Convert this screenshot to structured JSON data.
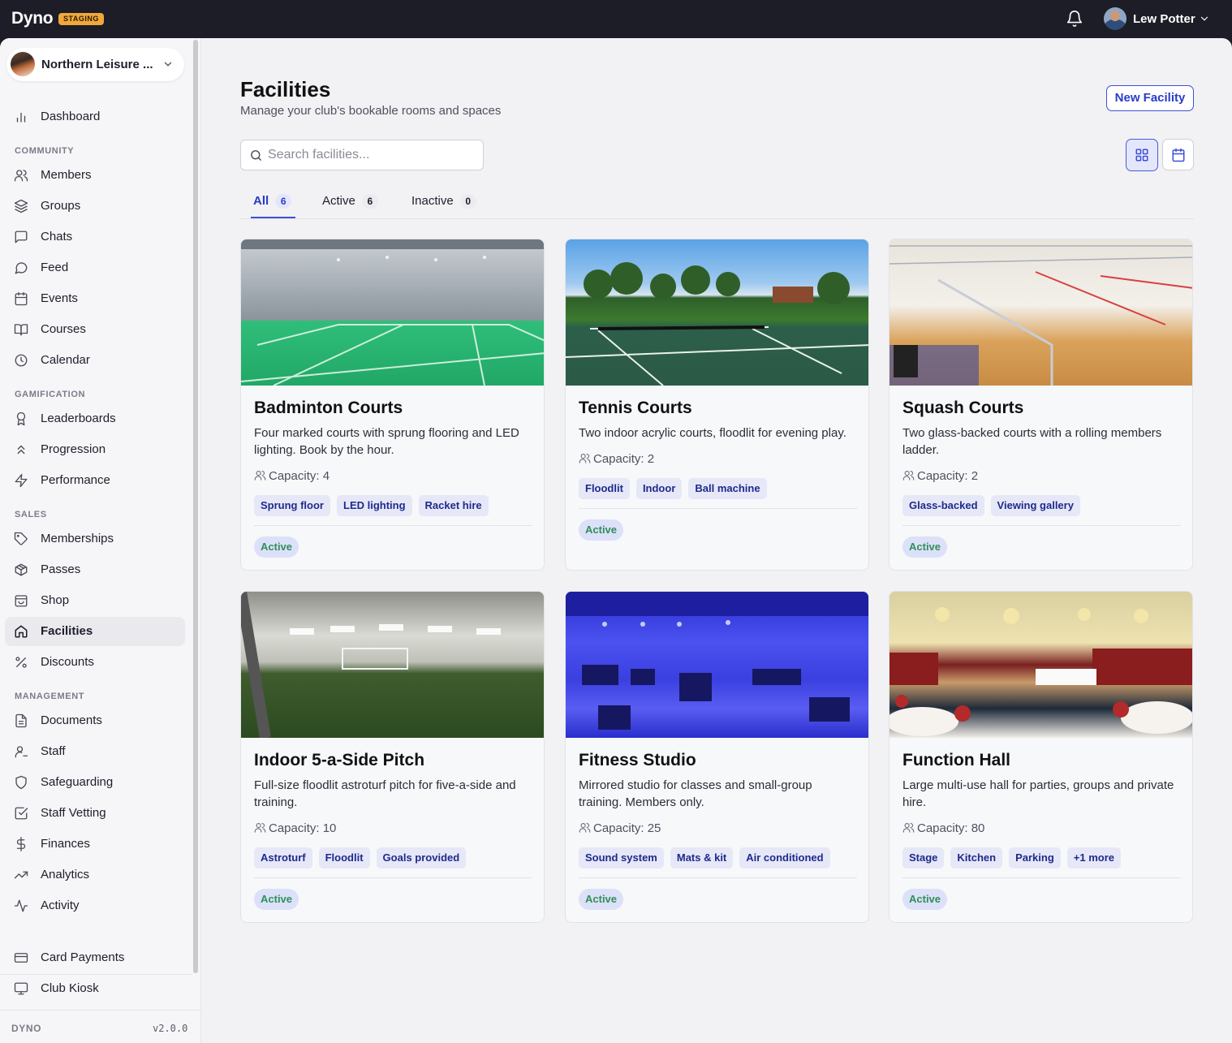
{
  "topbar": {
    "brand": "Dyno",
    "env_badge": "STAGING",
    "user_name": "Lew Potter"
  },
  "sidebar": {
    "org_name": "Northern Leisure ...",
    "items": [
      {
        "label": "Dashboard",
        "icon": "bar-chart-icon"
      },
      {
        "label": "Members",
        "icon": "users-icon"
      },
      {
        "label": "Groups",
        "icon": "layers-icon"
      },
      {
        "label": "Chats",
        "icon": "message-square-icon"
      },
      {
        "label": "Feed",
        "icon": "message-circle-icon"
      },
      {
        "label": "Events",
        "icon": "calendar-icon"
      },
      {
        "label": "Courses",
        "icon": "book-open-icon"
      },
      {
        "label": "Calendar",
        "icon": "clock-icon"
      },
      {
        "label": "Leaderboards",
        "icon": "award-icon"
      },
      {
        "label": "Progression",
        "icon": "chevrons-up-icon"
      },
      {
        "label": "Performance",
        "icon": "zap-icon"
      },
      {
        "label": "Memberships",
        "icon": "tag-icon"
      },
      {
        "label": "Passes",
        "icon": "package-icon"
      },
      {
        "label": "Shop",
        "icon": "shopping-bag-icon"
      },
      {
        "label": "Facilities",
        "icon": "home-icon",
        "active": true
      },
      {
        "label": "Discounts",
        "icon": "percent-icon"
      },
      {
        "label": "Documents",
        "icon": "file-text-icon"
      },
      {
        "label": "Staff",
        "icon": "user-icon"
      },
      {
        "label": "Safeguarding",
        "icon": "shield-icon"
      },
      {
        "label": "Staff Vetting",
        "icon": "check-square-icon"
      },
      {
        "label": "Finances",
        "icon": "dollar-sign-icon"
      },
      {
        "label": "Analytics",
        "icon": "trending-up-icon"
      },
      {
        "label": "Activity",
        "icon": "activity-icon"
      },
      {
        "label": "Card Payments",
        "icon": "credit-card-icon"
      },
      {
        "label": "Club Kiosk",
        "icon": "monitor-icon"
      }
    ],
    "sections": {
      "community": "COMMUNITY",
      "gamification": "GAMIFICATION",
      "sales": "SALES",
      "management": "MANAGEMENT"
    },
    "footer_left": "DYNO",
    "footer_right": "v2.0.0"
  },
  "main": {
    "title": "Facilities",
    "subtitle": "Manage your club's bookable rooms and spaces",
    "new_button": "New Facility",
    "search_placeholder": "Search facilities...",
    "tabs": [
      {
        "label": "All",
        "count": "6",
        "active": true
      },
      {
        "label": "Active",
        "count": "6"
      },
      {
        "label": "Inactive",
        "count": "0"
      }
    ],
    "cards": [
      {
        "title": "Badminton Courts",
        "description": "Four marked courts with sprung flooring and LED lighting. Book by the hour.",
        "capacity": "Capacity: 4",
        "features": [
          "Sprung floor",
          "LED lighting",
          "Racket hire"
        ],
        "status": "Active"
      },
      {
        "title": "Tennis Courts",
        "description": "Two indoor acrylic courts, floodlit for evening play.",
        "capacity": "Capacity: 2",
        "features": [
          "Floodlit",
          "Indoor",
          "Ball machine"
        ],
        "status": "Active"
      },
      {
        "title": "Squash Courts",
        "description": "Two glass-backed courts with a rolling members ladder.",
        "capacity": "Capacity: 2",
        "features": [
          "Glass-backed",
          "Viewing gallery"
        ],
        "status": "Active"
      },
      {
        "title": "Indoor 5-a-Side Pitch",
        "description": "Full-size floodlit astroturf pitch for five-a-side and training.",
        "capacity": "Capacity: 10",
        "features": [
          "Astroturf",
          "Floodlit",
          "Goals provided"
        ],
        "status": "Active"
      },
      {
        "title": "Fitness Studio",
        "description": "Mirrored studio for classes and small-group training. Members only.",
        "capacity": "Capacity: 25",
        "features": [
          "Sound system",
          "Mats & kit",
          "Air conditioned"
        ],
        "status": "Active"
      },
      {
        "title": "Function Hall",
        "description": "Large multi-use hall for parties, groups and private hire.",
        "capacity": "Capacity: 80",
        "features": [
          "Stage",
          "Kitchen",
          "Parking",
          "+1 more"
        ],
        "status": "Active"
      }
    ]
  },
  "colors": {
    "accent": "#3e4fd6",
    "topbar": "#1c1d26",
    "status_text": "#2f8f5a"
  }
}
